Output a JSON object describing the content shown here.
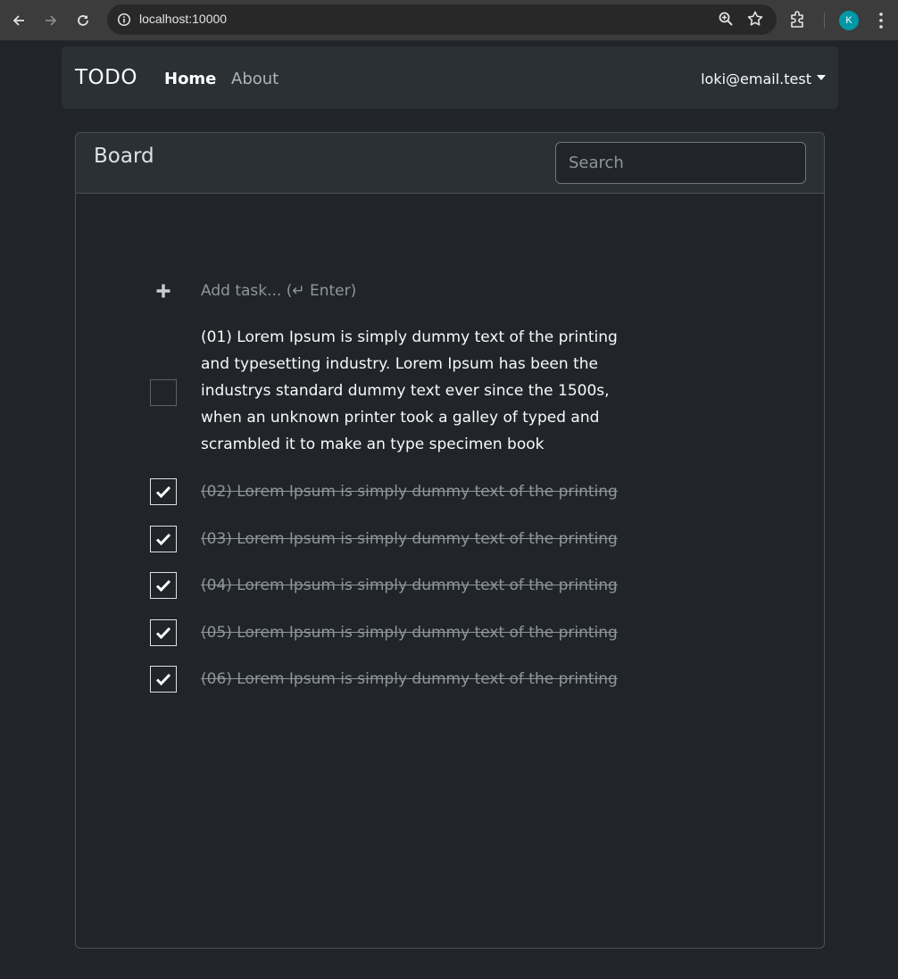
{
  "browser": {
    "url": "localhost:10000",
    "profile_initial": "K"
  },
  "navbar": {
    "brand": "TODO",
    "links": [
      {
        "label": "Home",
        "active": true
      },
      {
        "label": "About",
        "active": false
      }
    ],
    "user_email": "loki@email.test"
  },
  "board": {
    "title": "Board",
    "search_placeholder": "Search",
    "add_task_placeholder": "Add task... (↵ Enter)",
    "tasks": [
      {
        "text": "(01) Lorem Ipsum is simply dummy text of the printing and typesetting industry. Lorem Ipsum has been the industrys standard dummy text ever since the 1500s, when an unknown printer took a galley of typed and scrambled it to make an type specimen book",
        "done": false
      },
      {
        "text": "(02) Lorem Ipsum is simply dummy text of the printing",
        "done": true
      },
      {
        "text": "(03) Lorem Ipsum is simply dummy text of the printing",
        "done": true
      },
      {
        "text": "(04) Lorem Ipsum is simply dummy text of the printing",
        "done": true
      },
      {
        "text": "(05) Lorem Ipsum is simply dummy text of the printing",
        "done": true
      },
      {
        "text": "(06) Lorem Ipsum is simply dummy text of the printing",
        "done": true
      }
    ]
  },
  "icons": [
    "back-icon",
    "forward-icon",
    "reload-icon",
    "site-info-icon",
    "zoom-icon",
    "bookmark-star-icon",
    "extensions-icon",
    "menu-dots-icon",
    "plus-icon",
    "checkmark-icon"
  ]
}
